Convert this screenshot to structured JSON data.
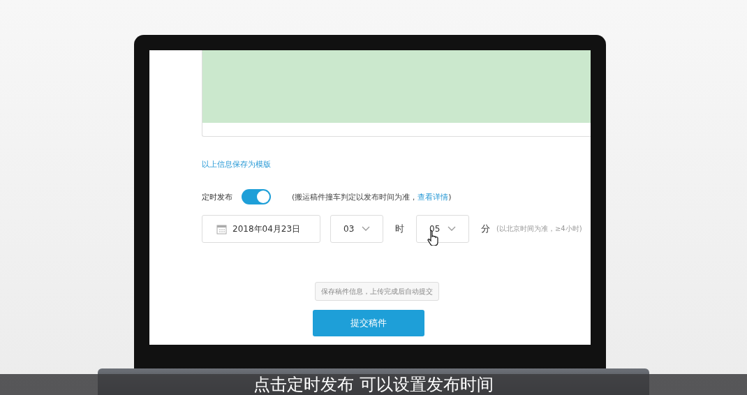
{
  "save_template_link": "以上信息保存为模版",
  "scheduled_publish": {
    "label": "定时发布",
    "on": true,
    "note": "(搬运稿件撞车判定以发布时间为准，",
    "note_link": "查看详情",
    "note_end": ")"
  },
  "schedule": {
    "date": "2018年04月23日",
    "hour": "03",
    "hour_unit": "时",
    "minute": "05",
    "minute_unit": "分",
    "hint": "(以北京时间为准，≥4小时)"
  },
  "tooltip": "保存稿件信息，上传完成后自动提交",
  "submit_button": "提交稿件",
  "caption": "点击定时发布 可以设置发布时间"
}
